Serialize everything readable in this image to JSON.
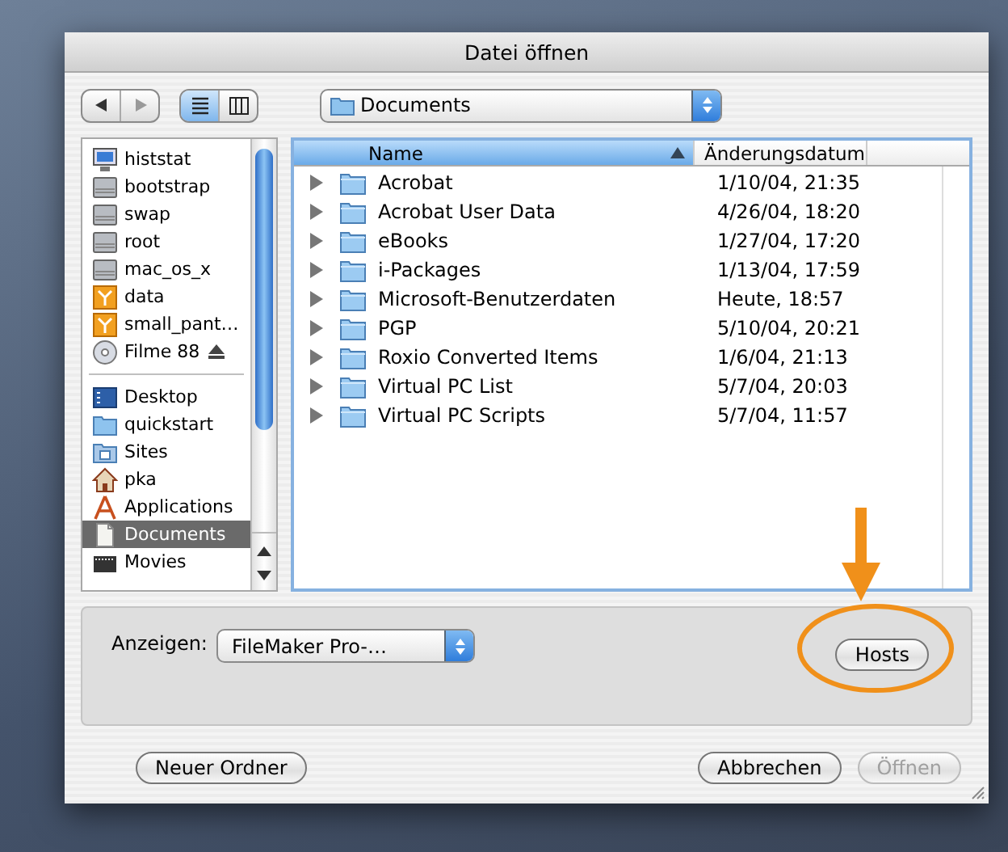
{
  "window": {
    "title": "Datei öffnen"
  },
  "toolbar": {
    "view_modes": [
      {
        "kind": "list",
        "selected": true
      },
      {
        "kind": "columns",
        "selected": false
      }
    ],
    "location": {
      "value": "Documents"
    }
  },
  "sidebar": {
    "sections": [
      {
        "items": [
          {
            "label": "histstat",
            "kind": "computer",
            "selected": false,
            "eject": false
          },
          {
            "label": "bootstrap",
            "kind": "disk",
            "selected": false,
            "eject": false
          },
          {
            "label": "swap",
            "kind": "disk",
            "selected": false,
            "eject": false
          },
          {
            "label": "root",
            "kind": "disk",
            "selected": false,
            "eject": false
          },
          {
            "label": "mac_os_x",
            "kind": "disk",
            "selected": false,
            "eject": false
          },
          {
            "label": "data",
            "kind": "server",
            "selected": false,
            "eject": false
          },
          {
            "label": "small_pant…",
            "kind": "server",
            "selected": false,
            "eject": false
          },
          {
            "label": "Filme 88",
            "kind": "cd",
            "selected": false,
            "eject": true
          }
        ]
      },
      {
        "items": [
          {
            "label": "Desktop",
            "kind": "desktop",
            "selected": false,
            "eject": false
          },
          {
            "label": "quickstart",
            "kind": "folder",
            "selected": false,
            "eject": false
          },
          {
            "label": "Sites",
            "kind": "sites",
            "selected": false,
            "eject": false
          },
          {
            "label": "pka",
            "kind": "home",
            "selected": false,
            "eject": false
          },
          {
            "label": "Applications",
            "kind": "apps",
            "selected": false,
            "eject": false
          },
          {
            "label": "Documents",
            "kind": "document",
            "selected": true,
            "eject": false
          },
          {
            "label": "Movies",
            "kind": "movies",
            "selected": false,
            "eject": false
          }
        ]
      }
    ]
  },
  "file_list": {
    "columns": [
      {
        "label": "Name",
        "sorted": true
      },
      {
        "label": "Änderungsdatum",
        "sorted": false
      }
    ],
    "rows": [
      {
        "name": "Acrobat",
        "date": "1/10/04, 21:35",
        "expanded": false
      },
      {
        "name": "Acrobat User Data",
        "date": "4/26/04, 18:20",
        "expanded": false
      },
      {
        "name": "eBooks",
        "date": "1/27/04, 17:20",
        "expanded": false
      },
      {
        "name": "i-Packages",
        "date": "1/13/04, 17:59",
        "expanded": false
      },
      {
        "name": "Microsoft-Benutzerdaten",
        "date": "Heute, 18:57",
        "expanded": false
      },
      {
        "name": "PGP",
        "date": "5/10/04, 20:21",
        "expanded": false
      },
      {
        "name": "Roxio Converted Items",
        "date": "1/6/04, 21:13",
        "expanded": false
      },
      {
        "name": "Virtual PC List",
        "date": "5/7/04, 20:03",
        "expanded": false
      },
      {
        "name": "Virtual PC Scripts",
        "date": "5/7/04, 11:57",
        "expanded": false
      }
    ]
  },
  "options": {
    "label": "Anzeigen:",
    "value": "FileMaker Pro-…",
    "hosts_button": "Hosts"
  },
  "buttons": [
    {
      "label": "Neuer Ordner",
      "disabled": false
    },
    {
      "label": "Abbrechen",
      "disabled": false
    },
    {
      "label": "Öffnen",
      "disabled": true
    }
  ]
}
